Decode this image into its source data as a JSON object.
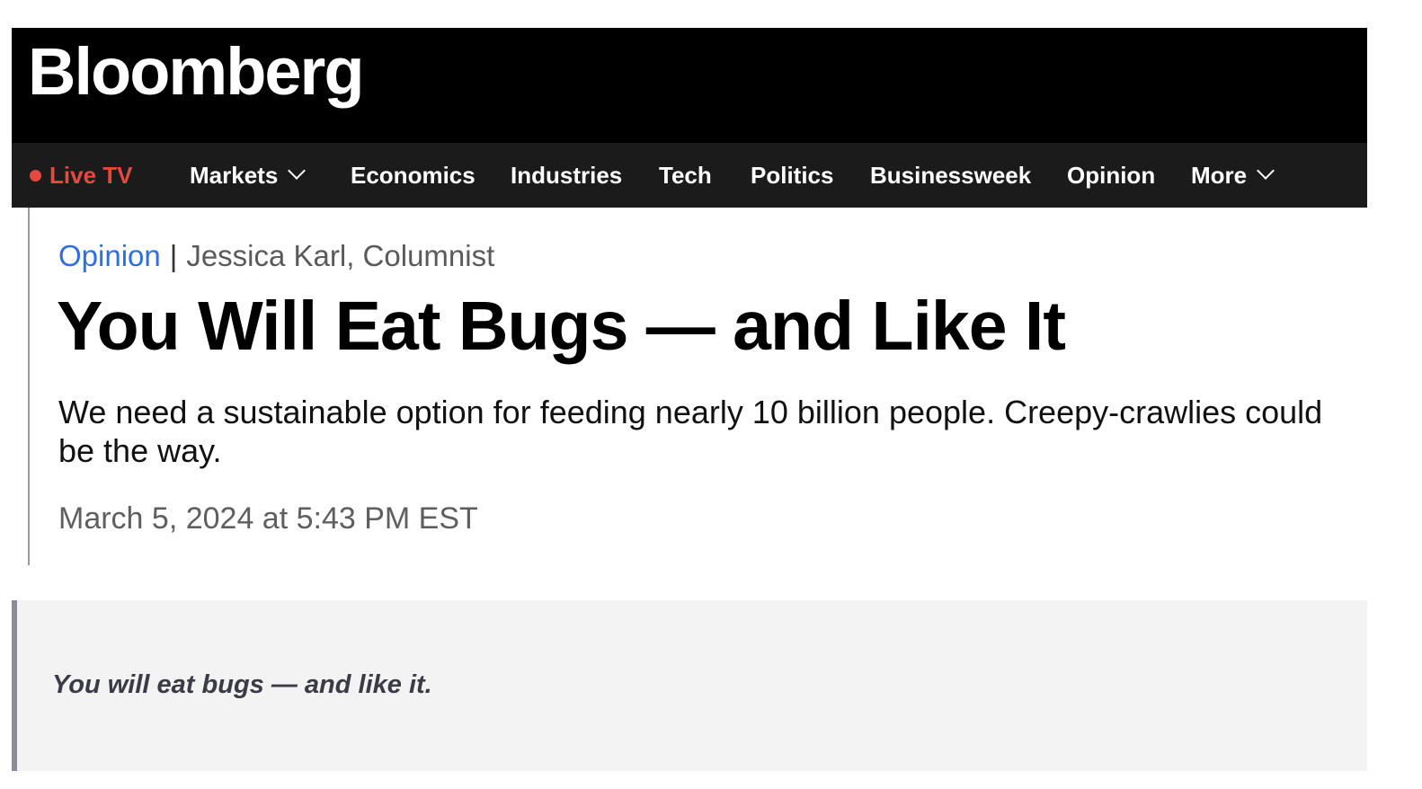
{
  "header": {
    "logo_text": "Bloomberg"
  },
  "nav": {
    "items": [
      {
        "label": "Live TV"
      },
      {
        "label": "Markets"
      },
      {
        "label": "Economics"
      },
      {
        "label": "Industries"
      },
      {
        "label": "Tech"
      },
      {
        "label": "Politics"
      },
      {
        "label": "Businessweek"
      },
      {
        "label": "Opinion"
      },
      {
        "label": "More"
      }
    ]
  },
  "article": {
    "section": "Opinion",
    "separator": "|",
    "author": "Jessica Karl, Columnist",
    "headline": "You Will Eat Bugs — and Like It",
    "dek": "We need a sustainable option for feeding nearly 10 billion people. Creepy-crawlies could be the way.",
    "timestamp": "March 5, 2024 at 5:43 PM EST",
    "pull_quote": "You will eat bugs — and like it."
  },
  "colors": {
    "live_red": "#e5483f",
    "link_blue": "#2d6fe0",
    "masthead_bg": "#000000",
    "nav_bg": "#1b1b1b",
    "quote_bg": "#f3f3f4"
  }
}
